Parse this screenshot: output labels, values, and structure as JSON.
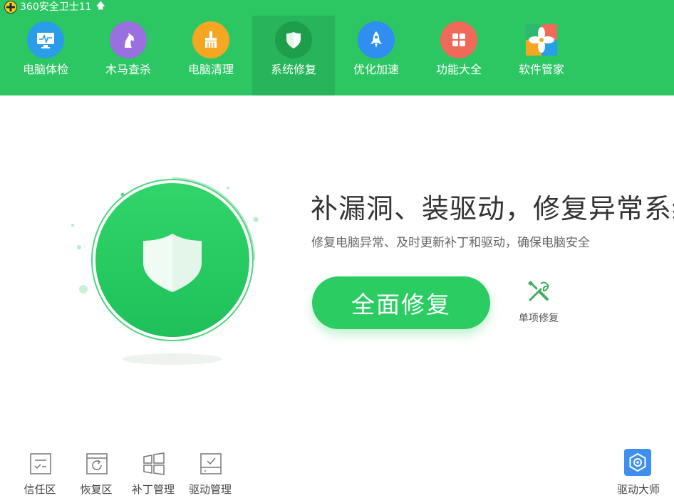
{
  "app": {
    "title": "360安全卫士11",
    "update_arrow": "🡅"
  },
  "nav": {
    "items": [
      {
        "label": "电脑体检",
        "icon": "monitor-icon",
        "color": "#2a9de8"
      },
      {
        "label": "木马查杀",
        "icon": "horse-icon",
        "color": "#9a6fe0"
      },
      {
        "label": "电脑清理",
        "icon": "broom-icon",
        "color": "#f5a623"
      },
      {
        "label": "系统修复",
        "icon": "shield-icon",
        "color": "#1e9e4a",
        "active": true
      },
      {
        "label": "优化加速",
        "icon": "rocket-icon",
        "color": "#2f8ef0"
      },
      {
        "label": "功能大全",
        "icon": "grid-icon",
        "color": "#f06a5a"
      },
      {
        "label": "软件管家",
        "icon": "flower-icon",
        "color": "#2fb870"
      }
    ]
  },
  "main": {
    "headline": "补漏洞、装驱动，修复异常系统",
    "subtitle": "修复电脑异常、及时更新补丁和驱动，确保电脑安全",
    "primary_button": "全面修复",
    "single_repair_label": "单项修复"
  },
  "bottom": {
    "tools": [
      {
        "label": "信任区",
        "icon": "trust-list-icon"
      },
      {
        "label": "恢复区",
        "icon": "restore-icon"
      },
      {
        "label": "补丁管理",
        "icon": "windows-icon"
      },
      {
        "label": "驱动管理",
        "icon": "driver-icon"
      }
    ],
    "driver_master_label": "驱动大师",
    "driver_master_icon": "gear-hex-icon"
  },
  "colors": {
    "brand_green": "#2cc663",
    "active_tab": "#27b45a",
    "button_green": "#2bcc62",
    "driver_blue": "#3d8ff0"
  }
}
